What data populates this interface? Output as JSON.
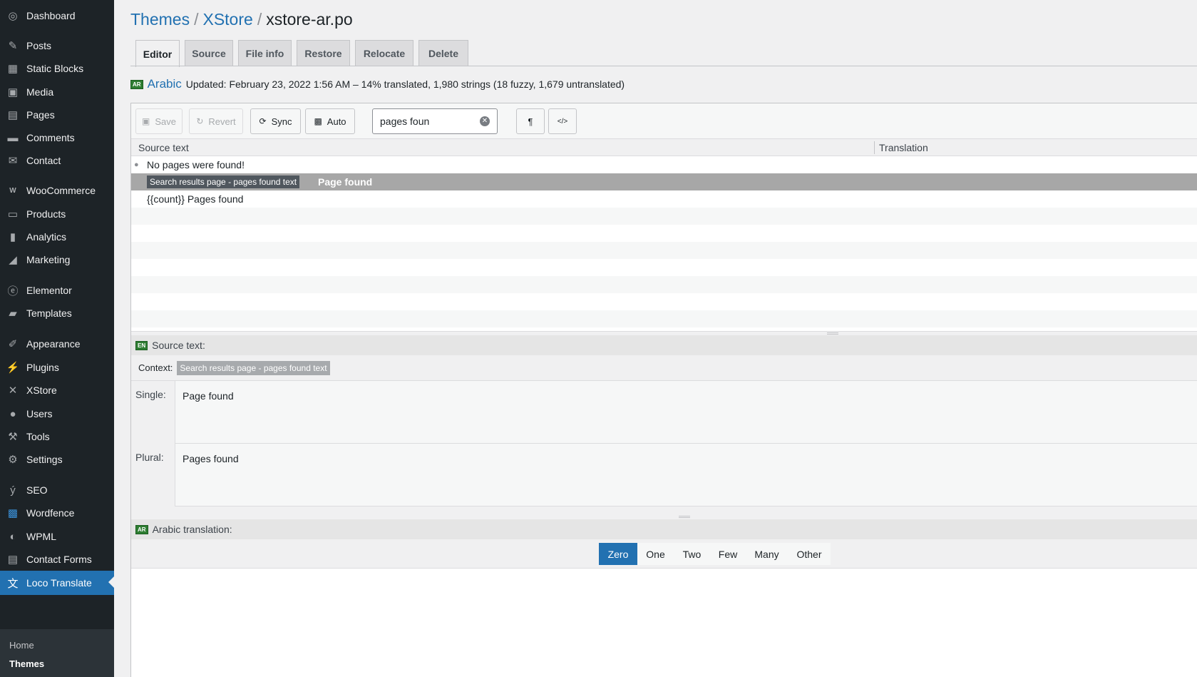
{
  "sidebar": {
    "items": [
      {
        "label": "Dashboard",
        "icon": "dashboard-icon",
        "glyph": "◎"
      },
      {
        "label": "Posts",
        "icon": "pushpin-icon",
        "glyph": "✎"
      },
      {
        "label": "Static Blocks",
        "icon": "grid-icon",
        "glyph": "▦"
      },
      {
        "label": "Media",
        "icon": "media-icon",
        "glyph": "▣"
      },
      {
        "label": "Pages",
        "icon": "pages-icon",
        "glyph": "▤"
      },
      {
        "label": "Comments",
        "icon": "comment-icon",
        "glyph": "▬"
      },
      {
        "label": "Contact",
        "icon": "envelope-icon",
        "glyph": "✉"
      },
      {
        "label": "WooCommerce",
        "icon": "woocommerce-icon",
        "glyph": "W"
      },
      {
        "label": "Products",
        "icon": "archive-icon",
        "glyph": "▭"
      },
      {
        "label": "Analytics",
        "icon": "bar-chart-icon",
        "glyph": "▮"
      },
      {
        "label": "Marketing",
        "icon": "megaphone-icon",
        "glyph": "◢"
      },
      {
        "label": "Elementor",
        "icon": "elementor-icon",
        "glyph": "ⓔ"
      },
      {
        "label": "Templates",
        "icon": "folder-icon",
        "glyph": "▰"
      },
      {
        "label": "Appearance",
        "icon": "brush-icon",
        "glyph": "✐"
      },
      {
        "label": "Plugins",
        "icon": "plug-icon",
        "glyph": "⚡"
      },
      {
        "label": "XStore",
        "icon": "xstore-icon",
        "glyph": "✕"
      },
      {
        "label": "Users",
        "icon": "user-icon",
        "glyph": "●"
      },
      {
        "label": "Tools",
        "icon": "wrench-icon",
        "glyph": "⚒"
      },
      {
        "label": "Settings",
        "icon": "settings-icon",
        "glyph": "⚙"
      },
      {
        "label": "SEO",
        "icon": "yoast-icon",
        "glyph": "ý"
      },
      {
        "label": "Wordfence",
        "icon": "wordfence-icon",
        "glyph": "▩"
      },
      {
        "label": "WPML",
        "icon": "wpml-icon",
        "glyph": "◐"
      },
      {
        "label": "Contact Forms",
        "icon": "form-icon",
        "glyph": "▤"
      },
      {
        "label": "Loco Translate",
        "icon": "translate-icon",
        "glyph": "文"
      }
    ],
    "submenu": {
      "home": "Home",
      "themes": "Themes"
    }
  },
  "breadcrumb": {
    "level1": "Themes",
    "level2": "XStore",
    "current": "xstore-ar.po",
    "separator": "/"
  },
  "tabs": [
    "Editor",
    "Source",
    "File info",
    "Restore",
    "Relocate",
    "Delete"
  ],
  "status": {
    "flag": "AR",
    "language": "Arabic",
    "text": "Updated: February 23, 2022 1:56 AM – 14% translated, 1,980 strings (18 fuzzy, 1,679 untranslated)"
  },
  "toolbar": {
    "save": "Save",
    "revert": "Revert",
    "sync": "Sync",
    "auto": "Auto",
    "search_value": "pages foun",
    "pilcrow": "¶",
    "code": "</>"
  },
  "list": {
    "col_source": "Source text",
    "col_translation": "Translation",
    "rows": [
      {
        "text": "No pages were found!"
      },
      {
        "context": "Search results page - pages found text",
        "text": "Page found"
      },
      {
        "text": "{{count}} Pages found"
      }
    ]
  },
  "source": {
    "flag": "EN",
    "header": "Source text:",
    "context_label": "Context:",
    "context_value": "Search results page - pages found text",
    "single_label": "Single:",
    "single_value": "Page found",
    "plural_label": "Plural:",
    "plural_value": "Pages found"
  },
  "translation": {
    "flag": "AR",
    "header": "Arabic translation:",
    "plural_tabs": [
      "Zero",
      "One",
      "Two",
      "Few",
      "Many",
      "Other"
    ]
  },
  "colors": {
    "accent": "#2271b1",
    "sidebar_bg": "#1d2327",
    "selected_row": "#a7a7a7"
  }
}
